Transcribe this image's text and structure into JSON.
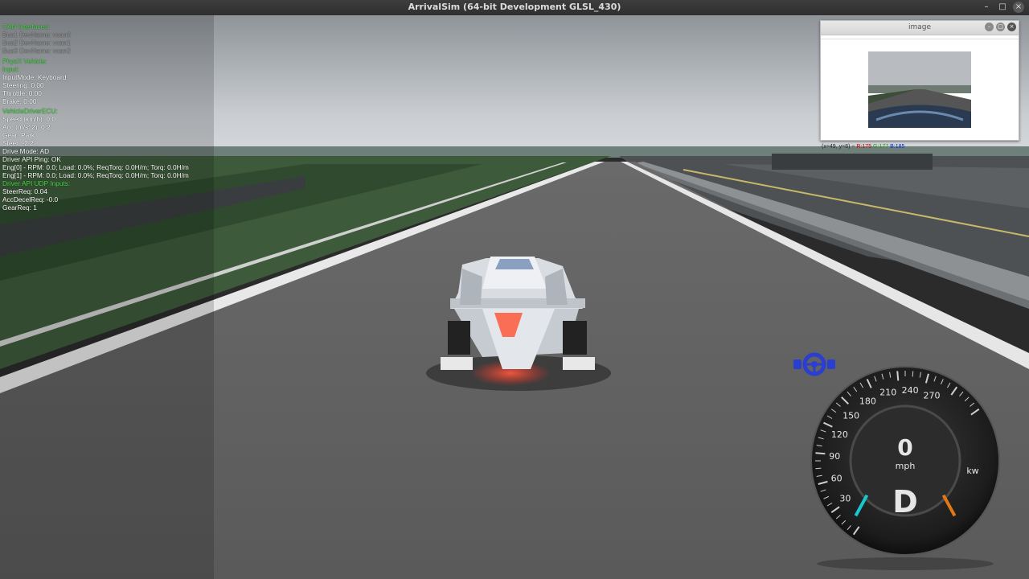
{
  "window": {
    "title": "ArrivalSim (64-bit Development GLSL_430)"
  },
  "hud": {
    "can_header": "CAN Interfaces:",
    "can_lines": [
      "Bus1 DevName: vcan0",
      "Bus2 DevName: vcan1",
      "Bus3 DevName: vcan2"
    ],
    "vehicle_header": "PhysX Vehicle:",
    "input_header": "Input:",
    "input_lines": [
      "InputMode: Keyboard",
      "Steering: 0.00",
      "Throttle: 0.00",
      "Brake: 0.00"
    ],
    "vdi_header": "VehicleDriverECU:",
    "vdi_lines": [
      "Speed (km/h): 0.0",
      "Acc (m/s^2): 0.2",
      "Gear: Park",
      "Steer: -2.2",
      "Drive Mode: AD",
      "Driver API Ping: OK",
      "Eng[0] -  RPM: 0.0; Load: 0.0%; ReqTorq: 0.0H/m; Torq: 0.0H/m",
      "Eng[1] -  RPM: 0.0; Load: 0.0%; ReqTorq: 0.0H/m; Torq: 0.0H/m"
    ],
    "udp_header": "Driver API UDP Inputs:",
    "udp_lines": [
      "SteerReq: 0.04",
      "AccDecelReq: -0.0",
      "GearReq: 1"
    ]
  },
  "image_window": {
    "title": "image",
    "status_prefix": "(x=49, y=8) ~",
    "r": "R:175",
    "g": "G:177",
    "b": "B:185"
  },
  "gauge": {
    "speed": "0",
    "unit": "mph",
    "gear": "D",
    "power_label": "kw",
    "ticks": [
      "30",
      "60",
      "90",
      "120",
      "150",
      "180",
      "210",
      "240",
      "270"
    ],
    "accent_left": "#18c8d0",
    "accent_right": "#e07818"
  },
  "icons": {
    "steering": "steering-wheel-icon"
  }
}
